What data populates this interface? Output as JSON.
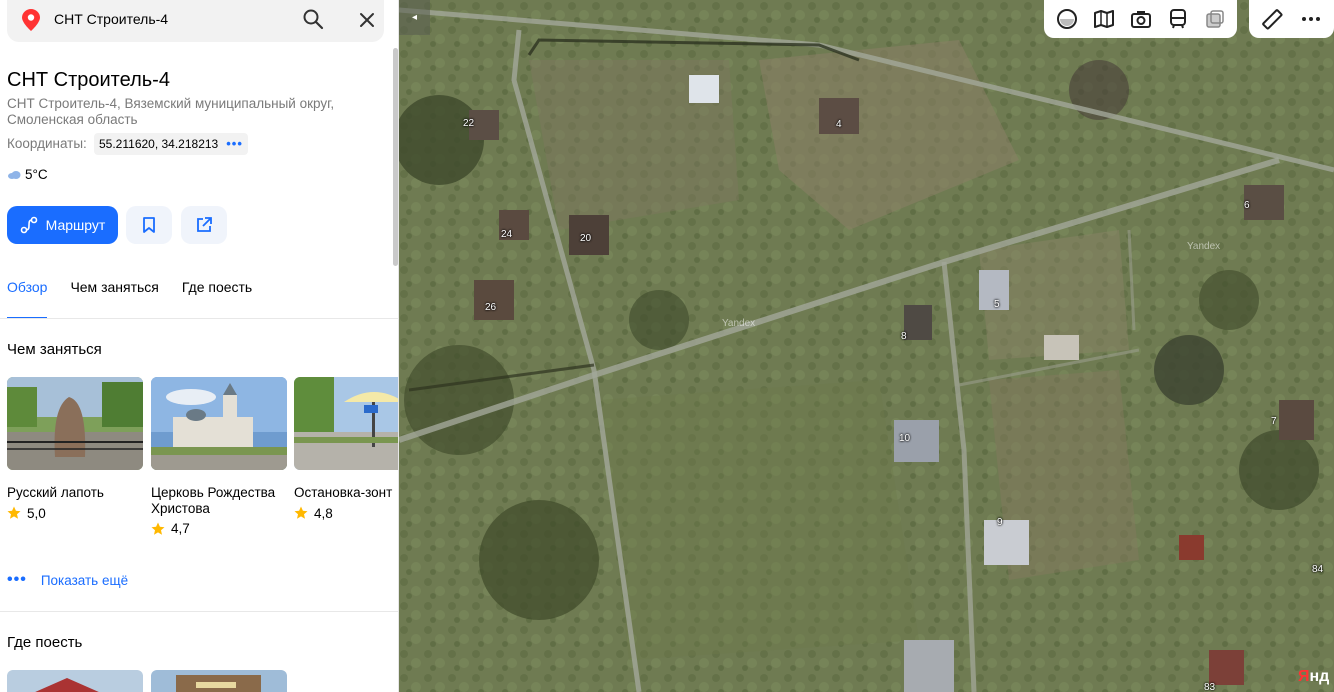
{
  "search": {
    "query": "СНТ Строитель-4"
  },
  "place": {
    "title": "СНТ Строитель-4",
    "address": "СНТ Строитель-4, Вяземский муниципальный округ, Смоленская область",
    "coords_label": "Координаты:",
    "coords_value": "55.211620, 34.218213",
    "weather": "5°C"
  },
  "actions": {
    "route_label": "Маршрут"
  },
  "tabs": [
    {
      "label": "Обзор",
      "active": true
    },
    {
      "label": "Чем заняться",
      "active": false
    },
    {
      "label": "Где поесть",
      "active": false
    }
  ],
  "things_to_do": {
    "heading": "Чем заняться",
    "cards": [
      {
        "name": "Русский лапоть",
        "rating": "5,0"
      },
      {
        "name": "Церковь Рождества Христова",
        "rating": "4,7"
      },
      {
        "name": "Остановка-зонт",
        "rating": "4,8"
      }
    ],
    "show_more": "Показать ещё"
  },
  "food": {
    "heading": "Где поесть"
  },
  "map": {
    "plot_labels": [
      "22",
      "4",
      "6",
      "24",
      "20",
      "26",
      "5",
      "8",
      "10",
      "7",
      "9",
      "84",
      "83"
    ],
    "watermark": "Yandex",
    "logo_prefix": "Я",
    "logo_rest": "нд"
  },
  "colors": {
    "accent": "#1a6dff",
    "star": "#ffb800"
  }
}
